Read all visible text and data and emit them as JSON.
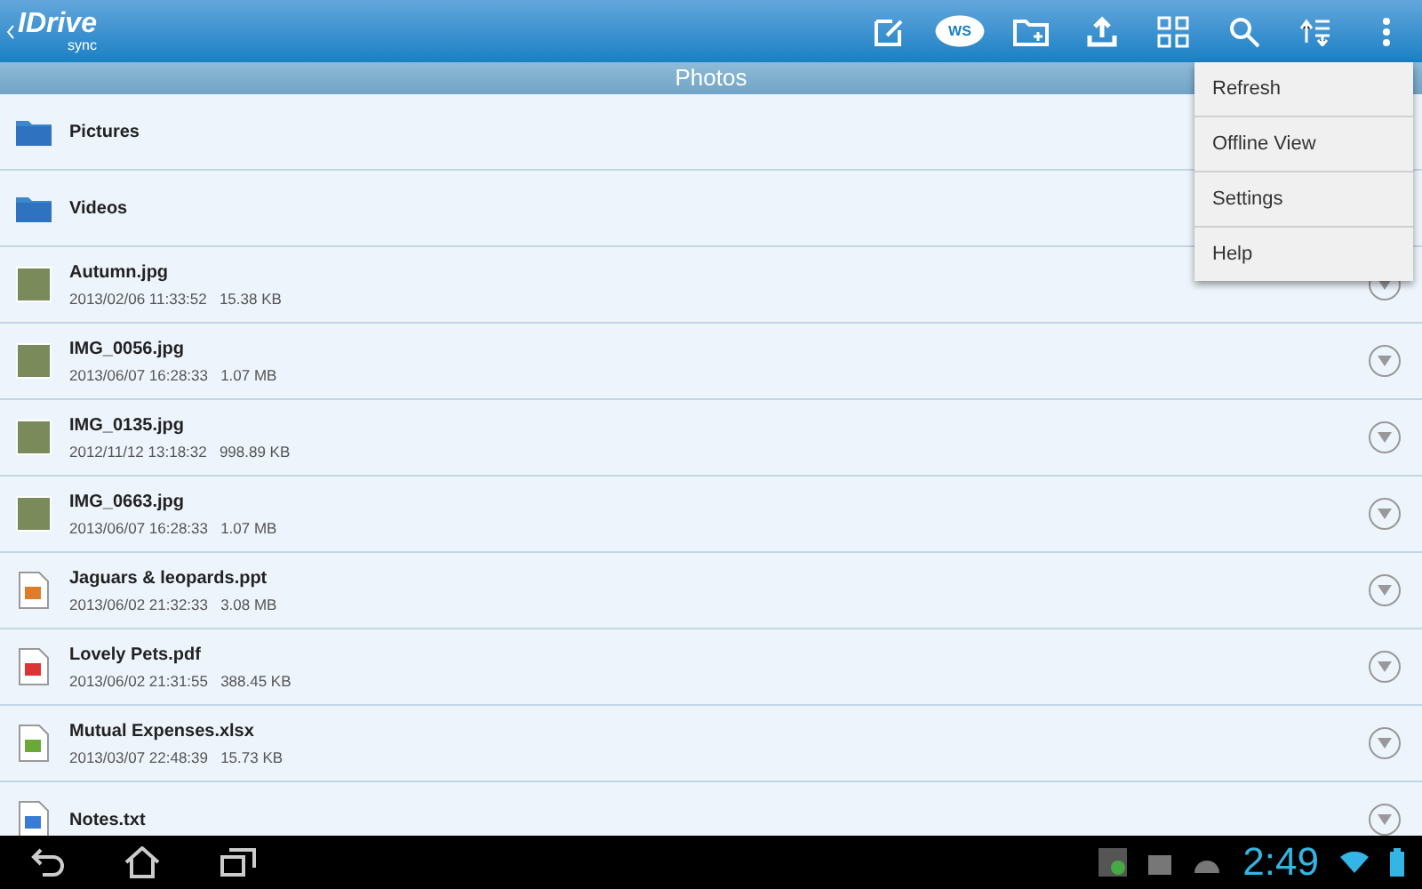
{
  "app_bar": {
    "logo": "IDrive",
    "logo_sub": "sync",
    "cloud_badge": "WS"
  },
  "folder_title": "Photos",
  "items": [
    {
      "kind": "folder",
      "name": "Pictures"
    },
    {
      "kind": "folder",
      "name": "Videos"
    },
    {
      "kind": "image",
      "name": "Autumn.jpg",
      "date": "2013/02/06 11:33:52",
      "size": "15.38 KB"
    },
    {
      "kind": "image",
      "name": "IMG_0056.jpg",
      "date": "2013/06/07 16:28:33",
      "size": "1.07 MB"
    },
    {
      "kind": "image",
      "name": "IMG_0135.jpg",
      "date": "2012/11/12 13:18:32",
      "size": "998.89 KB"
    },
    {
      "kind": "image",
      "name": "IMG_0663.jpg",
      "date": "2013/06/07 16:28:33",
      "size": "1.07 MB"
    },
    {
      "kind": "ppt",
      "name": "Jaguars & leopards.ppt",
      "date": "2013/06/02 21:32:33",
      "size": "3.08 MB"
    },
    {
      "kind": "pdf",
      "name": "Lovely Pets.pdf",
      "date": "2013/06/02 21:31:55",
      "size": "388.45 KB"
    },
    {
      "kind": "xls",
      "name": "Mutual Expenses.xlsx",
      "date": "2013/03/07 22:48:39",
      "size": "15.73 KB"
    },
    {
      "kind": "txt",
      "name": "Notes.txt"
    }
  ],
  "menu": [
    "Refresh",
    "Offline View",
    "Settings",
    "Help"
  ],
  "status_bar": {
    "time": "2:49"
  }
}
